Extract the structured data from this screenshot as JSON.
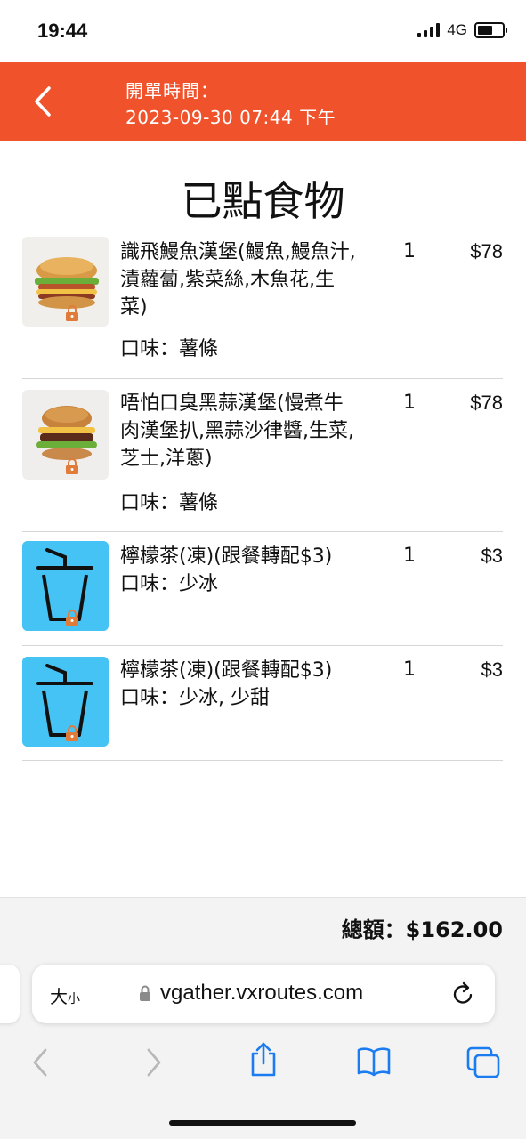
{
  "status_bar": {
    "time": "19:44",
    "network": "4G",
    "battery_level": 0.62
  },
  "header": {
    "label": "開單時間：",
    "datetime": "2023-09-30 07:44 下午",
    "background": "#f0532c",
    "back_icon": "chevron-left-icon"
  },
  "page_title": "已點食物",
  "items": [
    {
      "name": "識飛鰻魚漢堡(鰻魚,鰻魚汁,漬蘿蔔,紫菜絲,木魚花,生菜)",
      "option": "口味：薯條",
      "qty": "1",
      "price": "$78",
      "image": "burger-photo"
    },
    {
      "name": "唔怕口臭黑蒜漢堡(慢煮牛肉漢堡扒,黑蒜沙律醬,生菜,芝士,洋蔥)",
      "option": "口味：薯條",
      "qty": "1",
      "price": "$78",
      "image": "burger-photo"
    },
    {
      "name": "檸檬茶(凍)(跟餐轉配$3)",
      "option": "口味：少冰",
      "qty": "1",
      "price": "$3",
      "image": "cup-icon"
    },
    {
      "name": "檸檬茶(凍)(跟餐轉配$3)",
      "option": "口味：少冰, 少甜",
      "qty": "1",
      "price": "$3",
      "image": "cup-icon"
    }
  ],
  "total": "總額：$162.00",
  "browser": {
    "text_size_label": "大",
    "text_size_small": "小",
    "url": "vgather.vxroutes.com",
    "accent": "#1a7cf0"
  }
}
